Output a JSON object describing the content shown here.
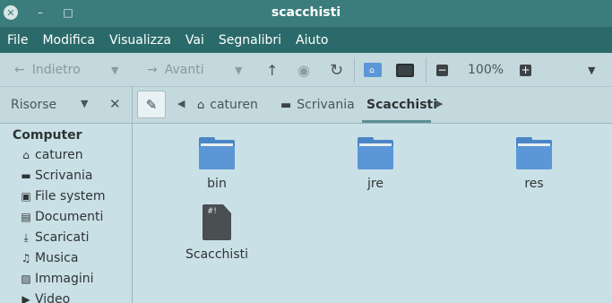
{
  "window": {
    "title": "scacchisti"
  },
  "menubar": {
    "items": [
      "File",
      "Modifica",
      "Visualizza",
      "Vai",
      "Segnalibri",
      "Aiuto"
    ]
  },
  "toolbar": {
    "back_label": "Indietro",
    "forward_label": "Avanti",
    "zoom": "100%"
  },
  "sidebar_header": {
    "label": "Risorse"
  },
  "breadcrumb": {
    "items": [
      "caturen",
      "Scrivania",
      "Scacchisti"
    ]
  },
  "sidebar": {
    "heading": "Computer",
    "items": [
      {
        "label": "caturen",
        "icon": "home-icon"
      },
      {
        "label": "Scrivania",
        "icon": "desktop-icon"
      },
      {
        "label": "File system",
        "icon": "drive-icon"
      },
      {
        "label": "Documenti",
        "icon": "documents-icon"
      },
      {
        "label": "Scaricati",
        "icon": "download-icon"
      },
      {
        "label": "Musica",
        "icon": "music-icon"
      },
      {
        "label": "Immagini",
        "icon": "pictures-icon"
      },
      {
        "label": "Video",
        "icon": "video-icon"
      }
    ]
  },
  "files": [
    {
      "name": "bin",
      "type": "folder"
    },
    {
      "name": "jre",
      "type": "folder"
    },
    {
      "name": "res",
      "type": "folder"
    },
    {
      "name": "Scacchisti",
      "type": "script"
    }
  ],
  "colors": {
    "titlebar": "#3b7c7c",
    "menubar": "#2b6a6a",
    "folder": "#5b97d6",
    "background": "#c9e0e6"
  }
}
